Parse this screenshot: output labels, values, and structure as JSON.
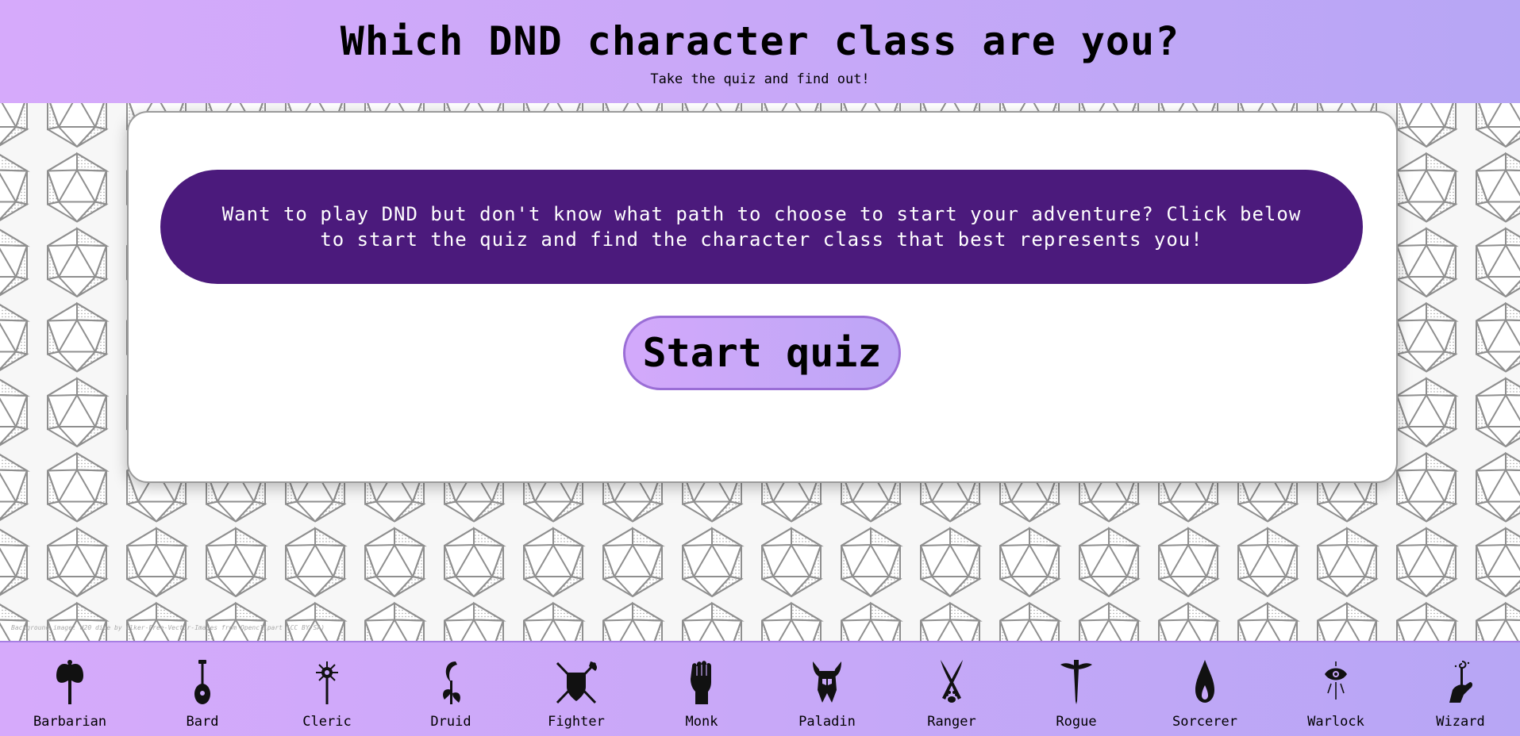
{
  "header": {
    "title": "Which DND character class are you?",
    "subtitle": "Take the quiz and find out!"
  },
  "intro": {
    "text": "Want to play DND but don't know what path to choose to start your adventure? Click below to start the quiz and find the character class that best represents you!"
  },
  "start_button": {
    "label": "Start quiz"
  },
  "background_credit": "Background image: d20 dice by Clker-Free-Vector-Images from Openclipart (CC BY-SA)",
  "classes": [
    {
      "name": "Barbarian",
      "icon": "axe-icon"
    },
    {
      "name": "Bard",
      "icon": "lute-icon"
    },
    {
      "name": "Cleric",
      "icon": "holy-mace-icon"
    },
    {
      "name": "Druid",
      "icon": "sickle-leaf-icon"
    },
    {
      "name": "Fighter",
      "icon": "crossed-weapons-shield-icon"
    },
    {
      "name": "Monk",
      "icon": "fist-icon"
    },
    {
      "name": "Paladin",
      "icon": "winged-helm-icon"
    },
    {
      "name": "Ranger",
      "icon": "crossed-blades-paw-icon"
    },
    {
      "name": "Rogue",
      "icon": "dagger-icon"
    },
    {
      "name": "Sorcerer",
      "icon": "flame-drop-icon"
    },
    {
      "name": "Warlock",
      "icon": "eye-icon"
    },
    {
      "name": "Wizard",
      "icon": "magic-hand-icon"
    }
  ],
  "colors": {
    "header_gradient_start": "#d6aafb",
    "header_gradient_end": "#b7a6f5",
    "intro_bg": "#4b1a7c",
    "button_border": "#9a6ed6"
  }
}
